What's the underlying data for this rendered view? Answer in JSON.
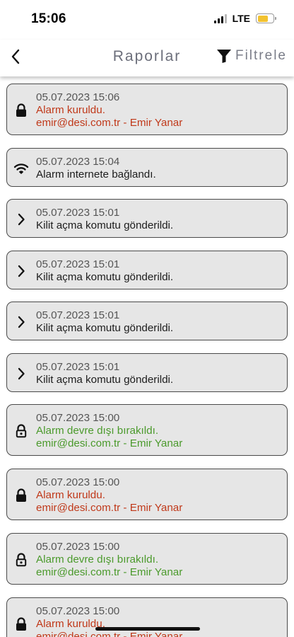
{
  "status_bar": {
    "time": "15:06",
    "network": "LTE"
  },
  "header": {
    "title": "Raporlar",
    "filter_label": "Filtrele"
  },
  "reports": [
    {
      "icon": "lock-icon",
      "date": "05.07.2023 15:06",
      "message": "Alarm kuruldu.",
      "user": "emir@desi.com.tr - Emir Yanar",
      "color": "#c0391a"
    },
    {
      "icon": "wifi-icon",
      "date": "05.07.2023 15:04",
      "message": "Alarm internete bağlandı."
    },
    {
      "icon": "chevron-right-icon",
      "date": "05.07.2023 15:01",
      "message": "Kilit açma komutu gönderildi."
    },
    {
      "icon": "chevron-right-icon",
      "date": "05.07.2023 15:01",
      "message": "Kilit açma komutu gönderildi."
    },
    {
      "icon": "chevron-right-icon",
      "date": "05.07.2023 15:01",
      "message": "Kilit açma komutu gönderildi."
    },
    {
      "icon": "chevron-right-icon",
      "date": "05.07.2023 15:01",
      "message": "Kilit açma komutu gönderildi."
    },
    {
      "icon": "unlock-icon",
      "date": "05.07.2023 15:00",
      "message": "Alarm devre dışı bırakıldı.",
      "user": "emir@desi.com.tr - Emir Yanar",
      "color": "#4b9a2c"
    },
    {
      "icon": "lock-icon",
      "date": "05.07.2023 15:00",
      "message": "Alarm kuruldu.",
      "user": "emir@desi.com.tr - Emir Yanar",
      "color": "#c0391a"
    },
    {
      "icon": "unlock-icon",
      "date": "05.07.2023 15:00",
      "message": "Alarm devre dışı bırakıldı.",
      "user": "emir@desi.com.tr - Emir Yanar",
      "color": "#4b9a2c"
    },
    {
      "icon": "lock-icon",
      "date": "05.07.2023 15:00",
      "message": "Alarm kuruldu.",
      "user": "emir@desi.com.tr - Emir Yanar",
      "color": "#c0391a"
    }
  ]
}
